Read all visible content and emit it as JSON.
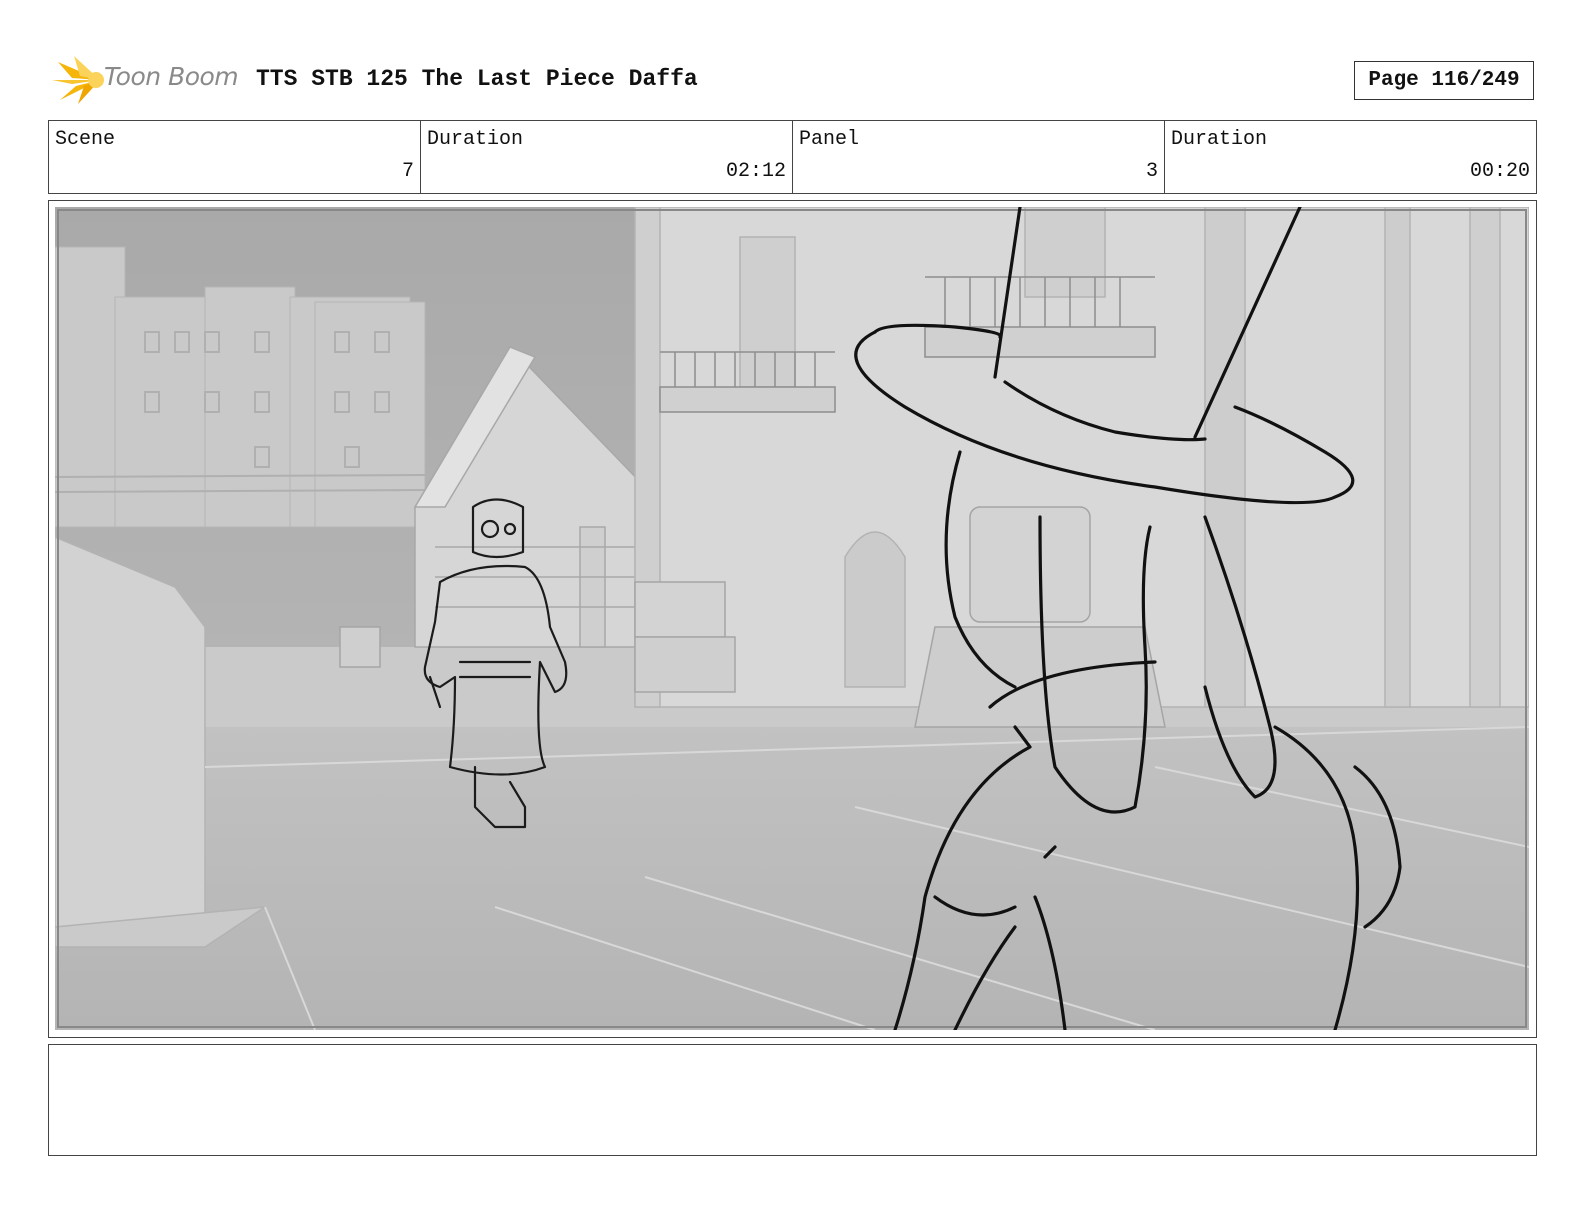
{
  "header": {
    "logo_text": "Toon Boom",
    "title": "TTS STB 125 The Last Piece Daffa",
    "page_label": "Page 116/249"
  },
  "info": [
    {
      "label": "Scene",
      "value": "7"
    },
    {
      "label": "Duration",
      "value": "02:12"
    },
    {
      "label": "Panel",
      "value": "3"
    },
    {
      "label": "Duration",
      "value": "00:20"
    }
  ],
  "notes": {
    "text": ""
  },
  "colors": {
    "logo_accent": "#f5b50a",
    "logo_text": "#8a8a8a",
    "border": "#444444"
  }
}
